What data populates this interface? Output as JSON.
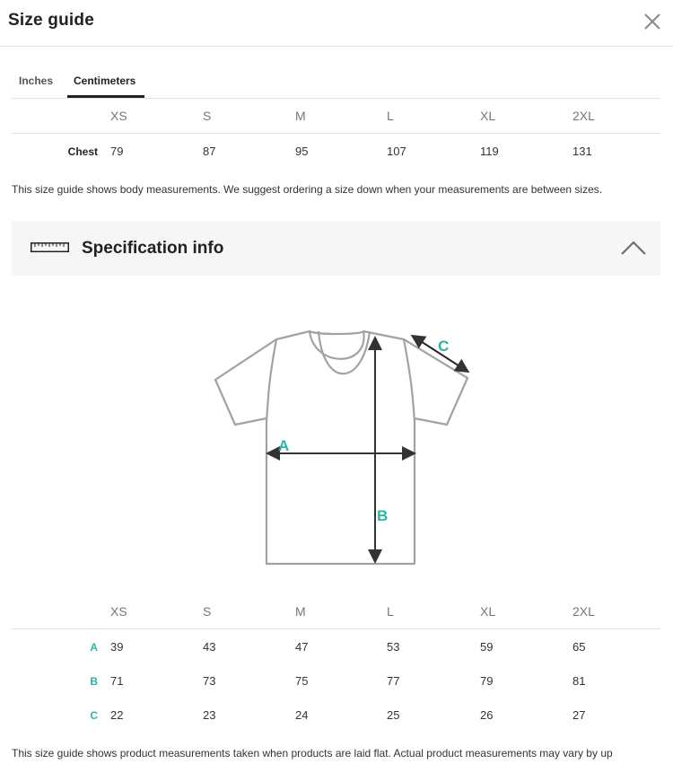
{
  "header": {
    "title": "Size guide",
    "close_icon": "close-icon"
  },
  "tabs": [
    {
      "label": "Inches",
      "active": false
    },
    {
      "label": "Centimeters",
      "active": true
    }
  ],
  "body_table": {
    "sizes": [
      "XS",
      "S",
      "M",
      "L",
      "XL",
      "2XL"
    ],
    "rows": [
      {
        "label": "Chest",
        "values": [
          "79",
          "87",
          "95",
          "107",
          "119",
          "131"
        ]
      }
    ]
  },
  "body_note": "This size guide shows body measurements. We suggest ordering a size down when your measurements are between sizes.",
  "spec": {
    "icon": "ruler-icon",
    "title": "Specification info",
    "toggle_icon": "chevron-up-icon",
    "expanded": true,
    "diagram_labels": {
      "a": "A",
      "b": "B",
      "c": "C"
    },
    "accent_color": "#2bb5a4"
  },
  "product_table": {
    "sizes": [
      "XS",
      "S",
      "M",
      "L",
      "XL",
      "2XL"
    ],
    "rows": [
      {
        "label": "A",
        "values": [
          "39",
          "43",
          "47",
          "53",
          "59",
          "65"
        ]
      },
      {
        "label": "B",
        "values": [
          "71",
          "73",
          "75",
          "77",
          "79",
          "81"
        ]
      },
      {
        "label": "C",
        "values": [
          "22",
          "23",
          "24",
          "25",
          "26",
          "27"
        ]
      }
    ]
  },
  "product_note": "This size guide shows product measurements taken when products are laid flat. Actual product measurements may vary by up"
}
